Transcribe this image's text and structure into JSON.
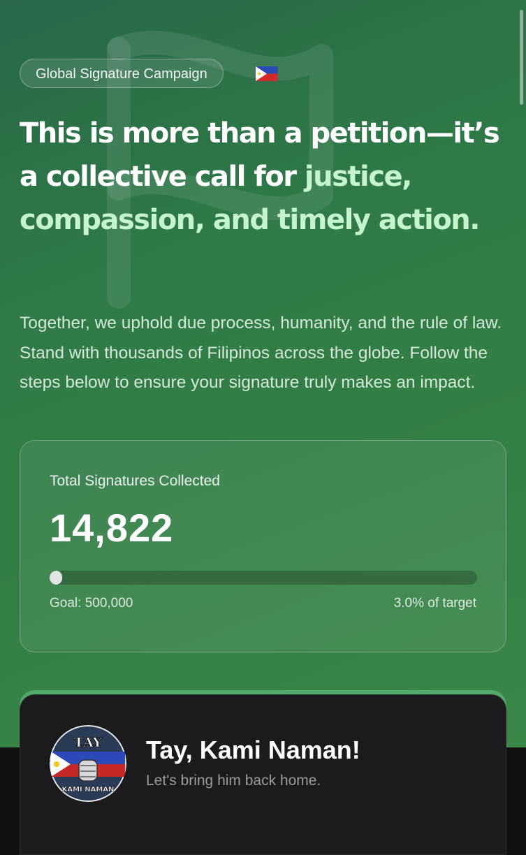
{
  "badge": {
    "label": "Global Signature Campaign",
    "flag_icon": "philippines-flag-icon"
  },
  "headline": {
    "part1": "This is more than a petition—it’s a collective call for ",
    "highlight": "justice, compassion, and timely action."
  },
  "lead": "Together, we uphold due process, humanity, and the rule of law. Stand with thousands of Filipinos across the globe. Follow the steps below to ensure your signature truly makes an impact.",
  "stats": {
    "label": "Total Signatures Collected",
    "count": "14,822",
    "progress_percent": 3.0,
    "goal": "Goal: 500,000",
    "percent_text": "3.0% of target"
  },
  "campaign_card": {
    "title": "Tay, Kami Naman!",
    "subtitle": "Let's bring him back home.",
    "logo": {
      "top": "TAY",
      "bottom": "KAMI NAMAN"
    }
  },
  "colors": {
    "hero_green": "#2f7a48",
    "highlight": "#c5f4cf",
    "card_bg": "#1b1b1e",
    "card_accent": "#53a86b"
  }
}
